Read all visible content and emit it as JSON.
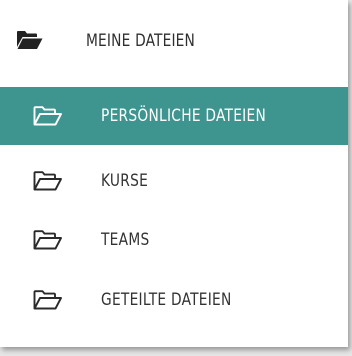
{
  "header": {
    "icon": "folder-open-filled-icon",
    "label": "MEINE DATEIEN"
  },
  "nav": {
    "items": [
      {
        "label": "PERSÖNLICHE DATEIEN",
        "icon": "folder-open-outline-icon",
        "active": true
      },
      {
        "label": "KURSE",
        "icon": "folder-open-outline-icon",
        "active": false
      },
      {
        "label": "TEAMS",
        "icon": "folder-open-outline-icon",
        "active": false
      },
      {
        "label": "GETEILTE DATEIEN",
        "icon": "folder-open-outline-icon",
        "active": false
      }
    ]
  },
  "colors": {
    "active_background": "#3e948f",
    "active_text": "#ffffff",
    "text": "#333333",
    "panel_background": "#ffffff"
  }
}
